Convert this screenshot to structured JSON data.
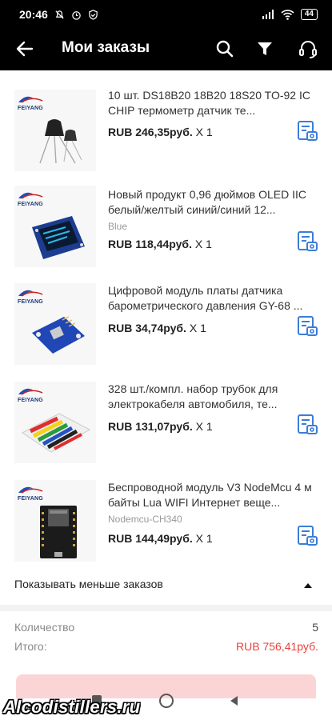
{
  "status_bar": {
    "time": "20:46",
    "battery": "44"
  },
  "app_bar": {
    "title": "Мои заказы",
    "icons": [
      "back-arrow-icon",
      "search-icon",
      "filter-icon",
      "headset-icon"
    ]
  },
  "brand": "FEIYANG",
  "items": [
    {
      "name": "10 шт. DS18B20 18B20 18S20 TO-92 IC CHIP термометр датчик те...",
      "variant": "",
      "price": "RUB 246,35руб.",
      "qty": "X 1"
    },
    {
      "name": "Новый продукт 0,96 дюймов OLED IIC белый/желтый синий/синий 12...",
      "variant": "Blue",
      "price": "RUB 118,44руб.",
      "qty": "X 1"
    },
    {
      "name": "Цифровой модуль платы датчика барометрического давления GY-68 ...",
      "variant": "",
      "price": "RUB 34,74руб.",
      "qty": "X 1"
    },
    {
      "name": "328 шт./компл. набор трубок для электрокабеля автомобиля, те...",
      "variant": "",
      "price": "RUB 131,07руб.",
      "qty": "X 1"
    },
    {
      "name": "Беспроводной модуль V3 NodeMcu 4 м байты Lua WIFI Интернет веще...",
      "variant": "Nodemcu-CH340",
      "price": "RUB 144,49руб.",
      "qty": "X 1"
    }
  ],
  "show_less_label": "Показывать меньше заказов",
  "summary": {
    "qty_label": "Количество",
    "qty_value": "5",
    "total_label": "Итого:",
    "total_value": "RUB 756,41руб."
  },
  "colors": {
    "accent": "#e64340",
    "bar": "#000000"
  },
  "watermark": "Alcodistillers.ru"
}
